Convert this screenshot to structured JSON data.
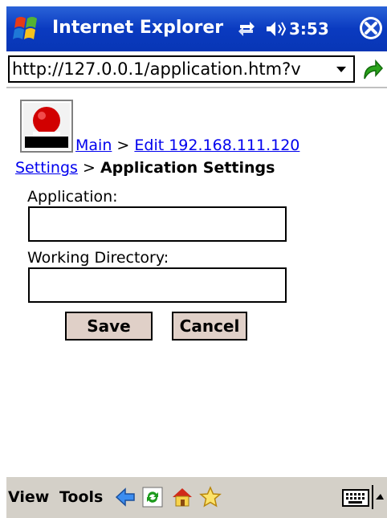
{
  "titlebar": {
    "title": "Internet Explorer",
    "clock": "3:53",
    "icons": [
      "start-flag-icon",
      "connectivity-icon",
      "volume-icon",
      "close-icon"
    ]
  },
  "address": {
    "url": "http://127.0.0.1/application.htm?v",
    "icons": [
      "dropdown-arrow-icon",
      "go-arrow-icon"
    ]
  },
  "content": {
    "breadcrumb": {
      "main_link": "Main",
      "separator": ">",
      "edit_link": "Edit 192.168.111.120",
      "settings_link": "Settings",
      "current": "Application Settings"
    },
    "form": {
      "application_label": "Application:",
      "application_value": "",
      "working_dir_label": "Working Directory:",
      "working_dir_value": "",
      "save_label": "Save",
      "cancel_label": "Cancel"
    }
  },
  "menubar": {
    "view_label": "View",
    "tools_label": "Tools",
    "icons": [
      "back-arrow-icon",
      "refresh-icon",
      "home-icon",
      "favorites-star-icon",
      "keyboard-icon",
      "sip-up-arrow-icon"
    ]
  },
  "colors": {
    "titlebar": "#0a3ac0",
    "link": "#0000ee",
    "button_face": "#e0d0c8",
    "menubar": "#d4d0c8"
  }
}
